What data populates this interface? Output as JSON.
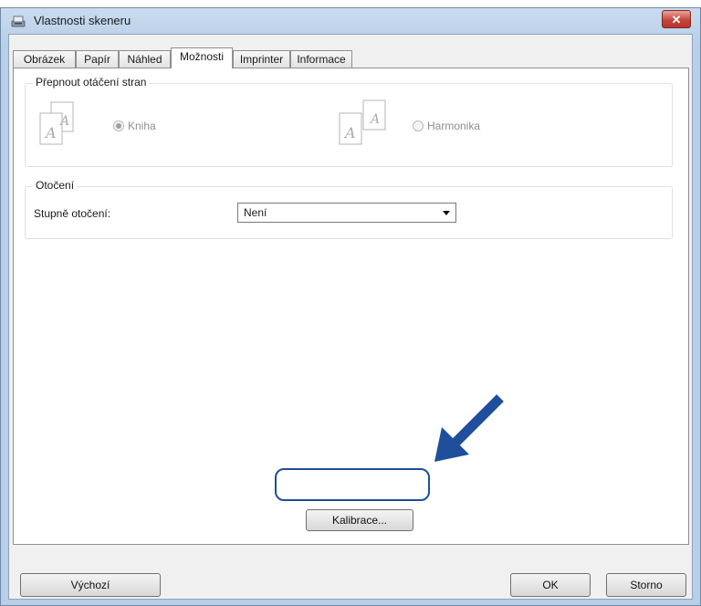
{
  "window": {
    "title": "Vlastnosti skeneru",
    "close_glyph": "✕"
  },
  "tabs": [
    "Obrázek",
    "Papír",
    "Náhled",
    "Možnosti",
    "Imprinter",
    "Informace"
  ],
  "active_tab": "Možnosti",
  "page_turn": {
    "group_title": "Přepnout otáčení stran",
    "option_book": "Kniha",
    "option_fanfold": "Harmonika",
    "selected": "Kniha",
    "enabled": false
  },
  "rotation": {
    "group_title": "Otočení",
    "degrees_label": "Stupně otočení:",
    "degrees_value": "Není"
  },
  "buttons": {
    "calibrate": "Kalibrace...",
    "default": "Výchozí",
    "ok": "OK",
    "cancel": "Storno"
  },
  "colors": {
    "accent_arrow": "#1f4f9a",
    "close_red": "#c8443a"
  },
  "icons": {
    "app": "scanner-icon",
    "doc": "document-page-icon",
    "annotation": "pointer-arrow-icon"
  }
}
